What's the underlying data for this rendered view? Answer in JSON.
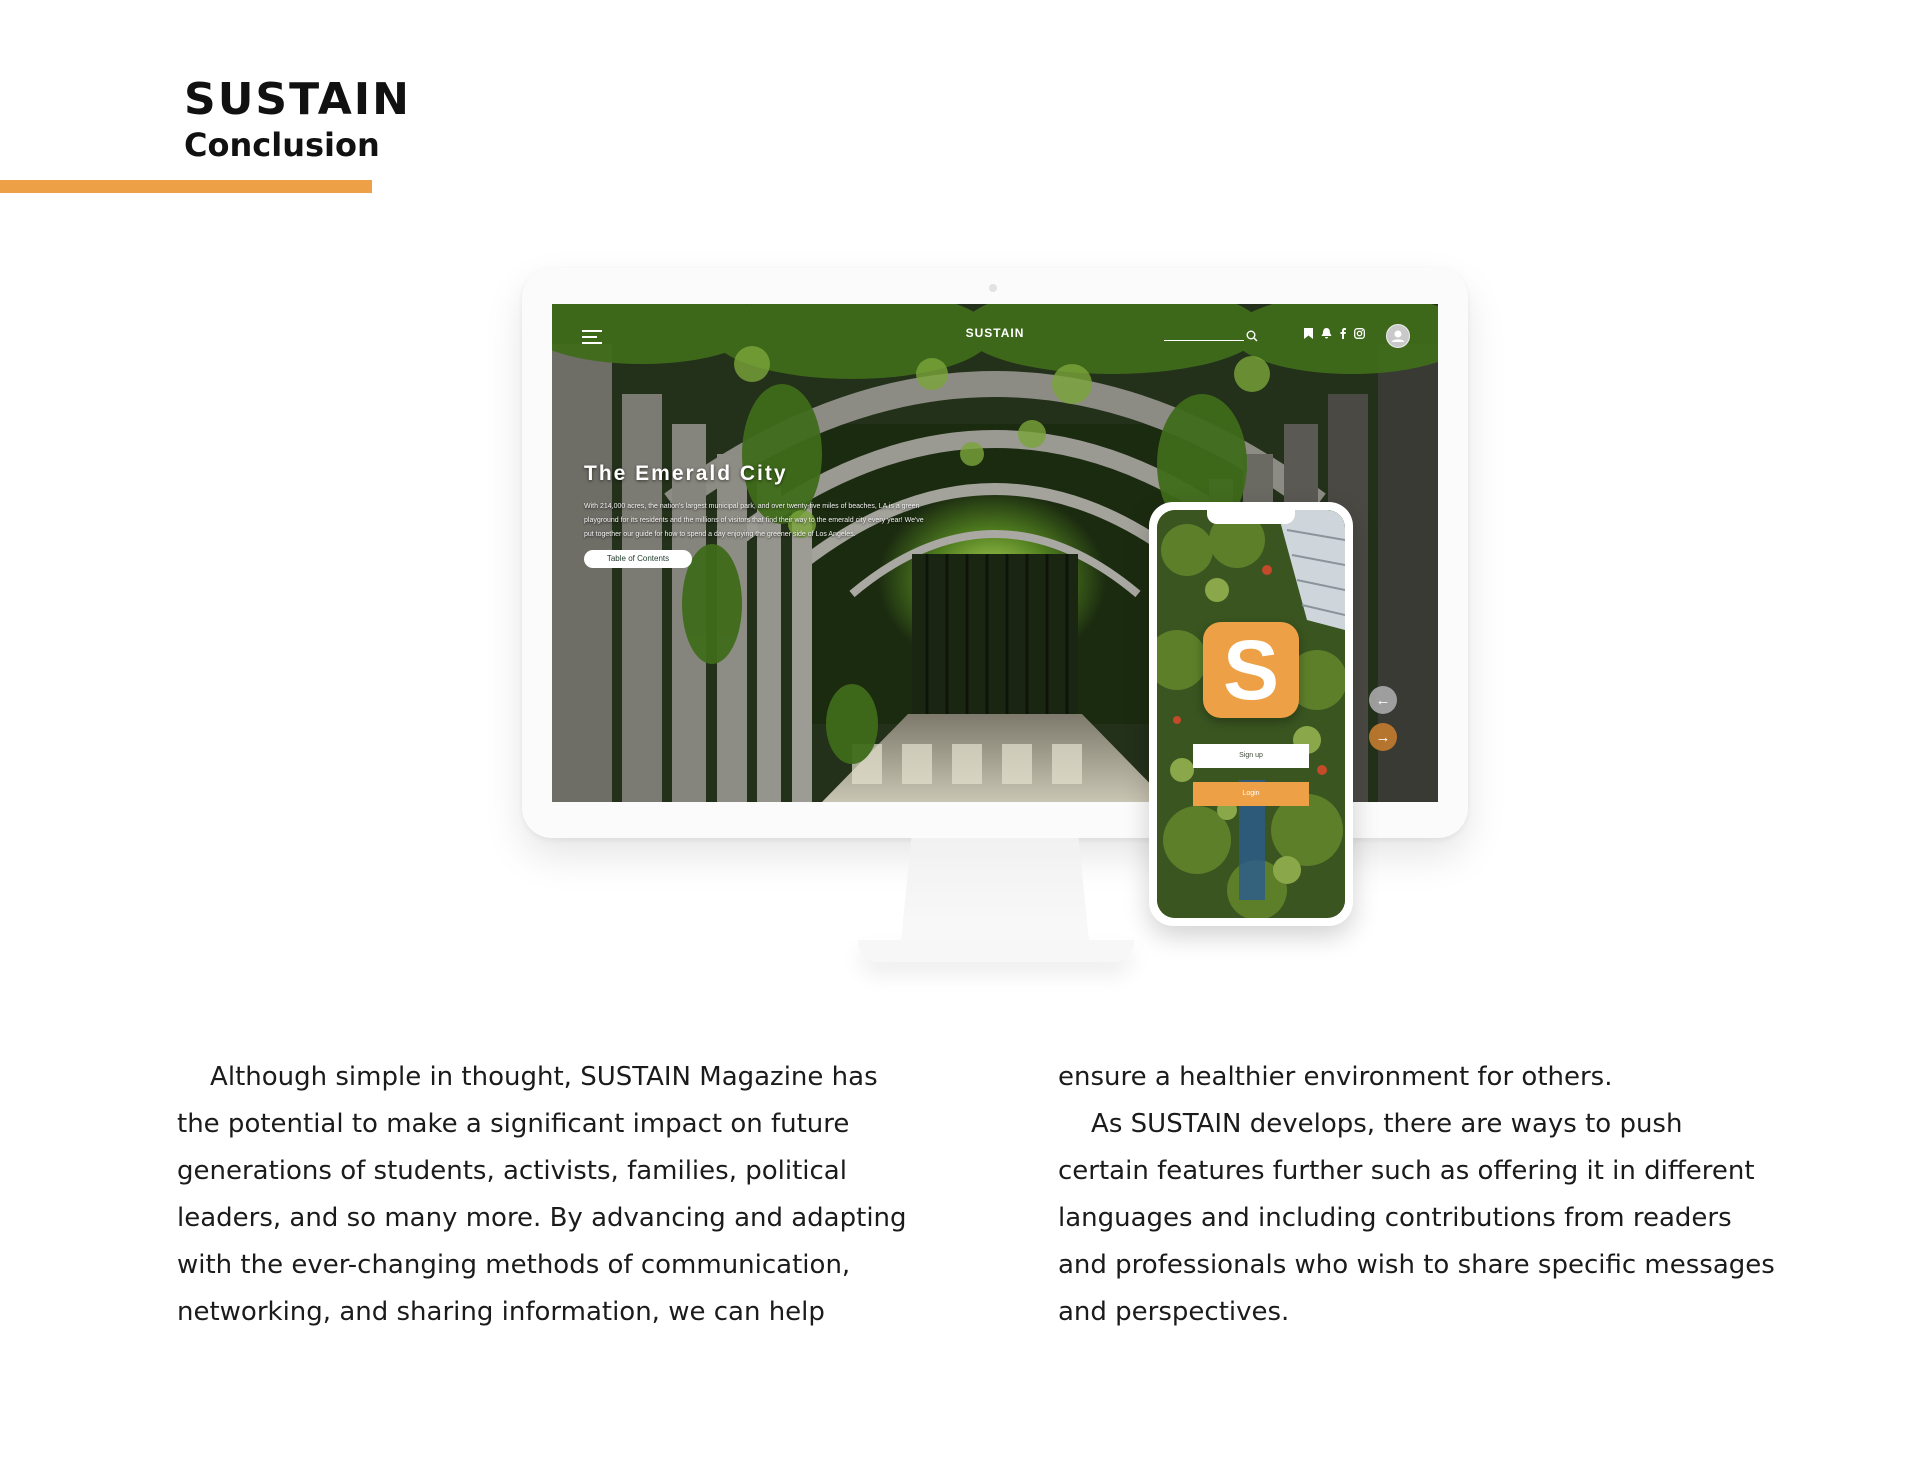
{
  "header": {
    "title": "SUSTAIN",
    "subtitle": "Conclusion",
    "accent_color": "#EDA045"
  },
  "desktop_site": {
    "logo": "SUSTAIN",
    "hero_title": "The Emerald City",
    "hero_description": "With 214,000 acres, the nation's largest municipal park, and over twenty-five miles of beaches, LA is a green playground for its residents and the millions of visitors that find their way to the emerald city every year! We've put together our guide for how to spend a day enjoying the greener side of Los Angeles.",
    "cta_label": "Table of Contents",
    "nav_icons": [
      "menu-icon",
      "search-icon",
      "bookmark-icon",
      "bell-icon",
      "facebook-icon",
      "instagram-icon",
      "user-icon"
    ],
    "arrow_prev": "←",
    "arrow_next": "→",
    "arrow_prev_color": "#9e9e9e",
    "arrow_next_color": "#B5752E"
  },
  "mobile_app": {
    "icon_letter": "S",
    "icon_color": "#EDA045",
    "signup_label": "Sign up",
    "login_label": "Login",
    "login_color": "#EDA045"
  },
  "body": {
    "left_lines": [
      "    Although simple in thought, SUSTAIN Magazine has",
      "the potential to make a significant impact on future",
      "generations of students, activists, families, political",
      "leaders, and so many more. By advancing and adapting",
      "with the ever-changing methods of communication,",
      "networking, and sharing information, we can help"
    ],
    "right_lines": [
      "ensure a healthier environment for others.",
      "    As SUSTAIN develops, there are ways to push",
      "certain features further such as offering it in different",
      "languages and including contributions from readers",
      "and professionals who wish to share specific messages",
      "and perspectives."
    ]
  }
}
